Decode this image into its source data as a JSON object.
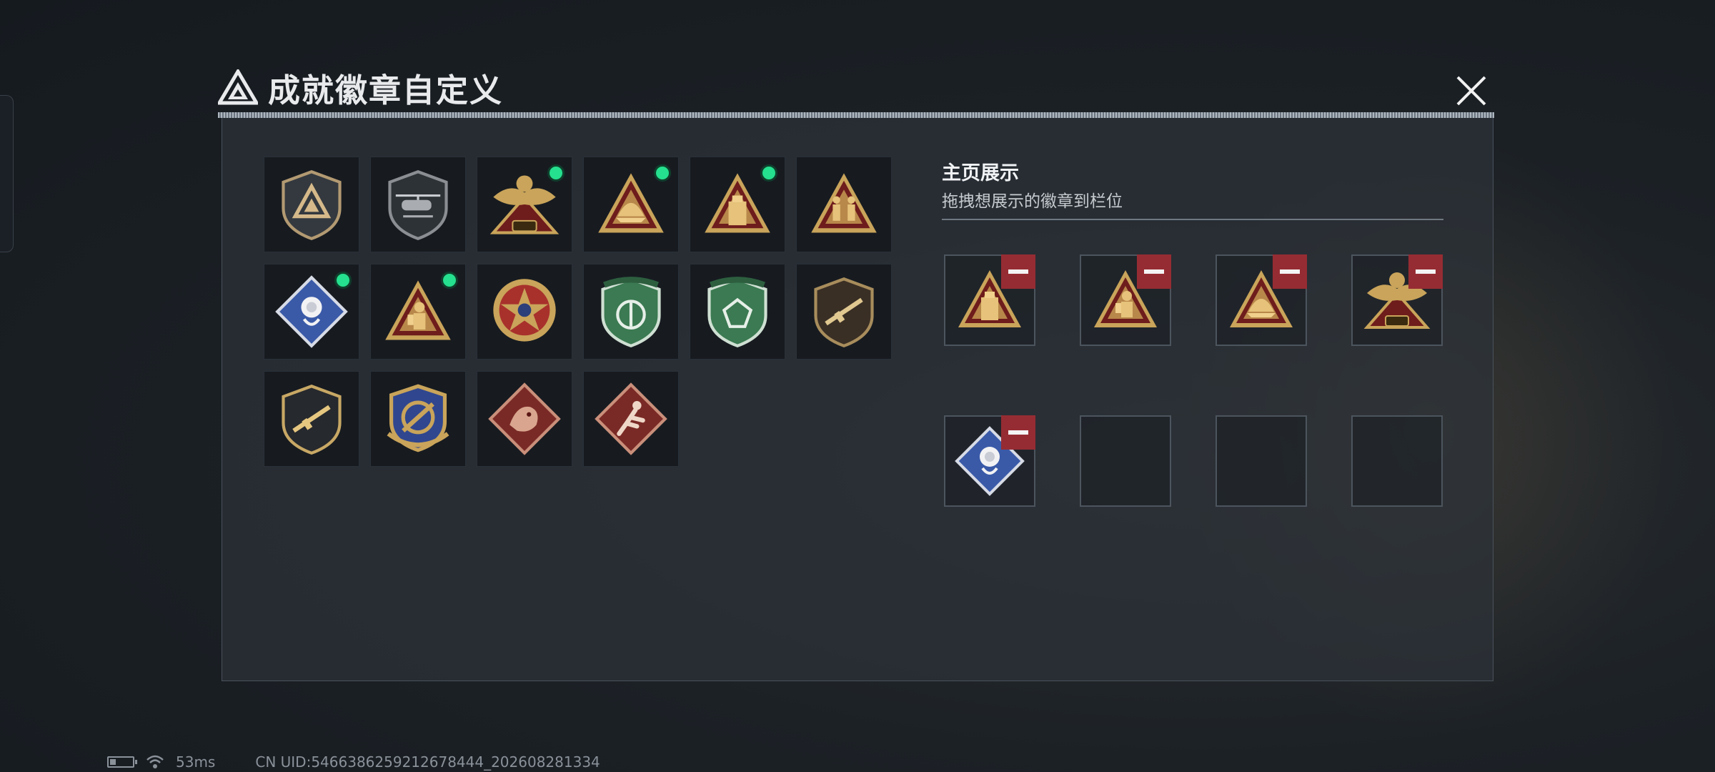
{
  "window": {
    "title": "成就徽章自定义"
  },
  "badges": [
    {
      "icon": "triangle-logo-shield-badge",
      "new": false
    },
    {
      "icon": "helicopter-shield-badge",
      "new": false
    },
    {
      "icon": "golden-eagle-518-badge",
      "new": true
    },
    {
      "icon": "golden-dome-triangle-badge",
      "new": true
    },
    {
      "icon": "usb-drive-triangle-badge",
      "new": true
    },
    {
      "icon": "soldiers-triangle-badge",
      "new": false
    },
    {
      "icon": "rose-diamond-badge",
      "new": true
    },
    {
      "icon": "hazmat-soldier-triangle-badge",
      "new": true
    },
    {
      "icon": "red-star-medal-badge",
      "new": false
    },
    {
      "icon": "green-wings-shield-badge",
      "new": false
    },
    {
      "icon": "green-gem-shield-badge",
      "new": false
    },
    {
      "icon": "rifle-shield-dark-badge",
      "new": false
    },
    {
      "icon": "rifle-shield-badge",
      "new": false
    },
    {
      "icon": "gold-blue-crest-badge",
      "new": false
    },
    {
      "icon": "dragon-diamond-badge",
      "new": false
    },
    {
      "icon": "runner-diamond-badge",
      "new": false
    }
  ],
  "display": {
    "title": "主页展示",
    "subtitle": "拖拽想展示的徽章到栏位",
    "slots": [
      {
        "icon": "usb-drive-triangle-badge",
        "filled": true
      },
      {
        "icon": "hazmat-soldier-triangle-badge",
        "filled": true
      },
      {
        "icon": "golden-dome-triangle-badge",
        "filled": true
      },
      {
        "icon": "golden-eagle-518-badge",
        "filled": true
      },
      {
        "icon": "rose-diamond-badge",
        "filled": true
      },
      {
        "icon": "empty-slot",
        "filled": false
      },
      {
        "icon": "empty-slot",
        "filled": false
      },
      {
        "icon": "empty-slot",
        "filled": false
      }
    ]
  },
  "status": {
    "ping": "53ms",
    "uid": "CN UID:5466386259212678444_202608281334"
  },
  "colors": {
    "new_dot": "#25e08e",
    "remove": "#962c33",
    "gold": "#c9a45a"
  }
}
